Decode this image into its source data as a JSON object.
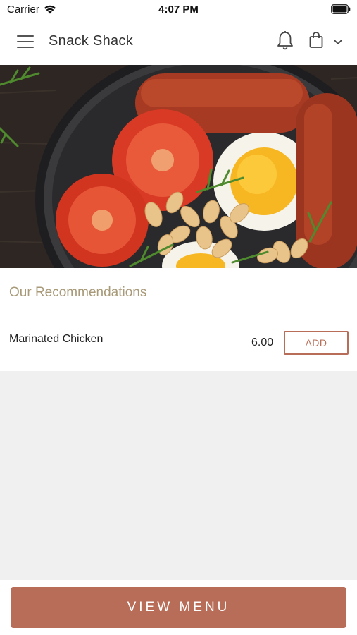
{
  "status_bar": {
    "carrier": "Carrier",
    "time": "4:07 PM",
    "wifi_icon": "wifi-icon",
    "battery_icon": "battery-icon"
  },
  "header": {
    "menu_icon": "hamburger-menu-icon",
    "title": "Snack Shack",
    "notification_icon": "bell-icon",
    "cart_icon": "shopping-bag-icon",
    "dropdown_icon": "chevron-down-icon"
  },
  "hero": {
    "image_subject": "breakfast skillet with sausages, fried eggs, tomatoes and beans"
  },
  "recommendations": {
    "title": "Our Recommendations",
    "items": [
      {
        "name": "Marinated Chicken",
        "price": "6.00",
        "button_label": "ADD"
      }
    ]
  },
  "footer": {
    "view_menu_label": "VIEW MENU"
  },
  "colors": {
    "accent": "#b86d58",
    "section_title": "#a89a78",
    "page_background": "#f0f0f0"
  }
}
